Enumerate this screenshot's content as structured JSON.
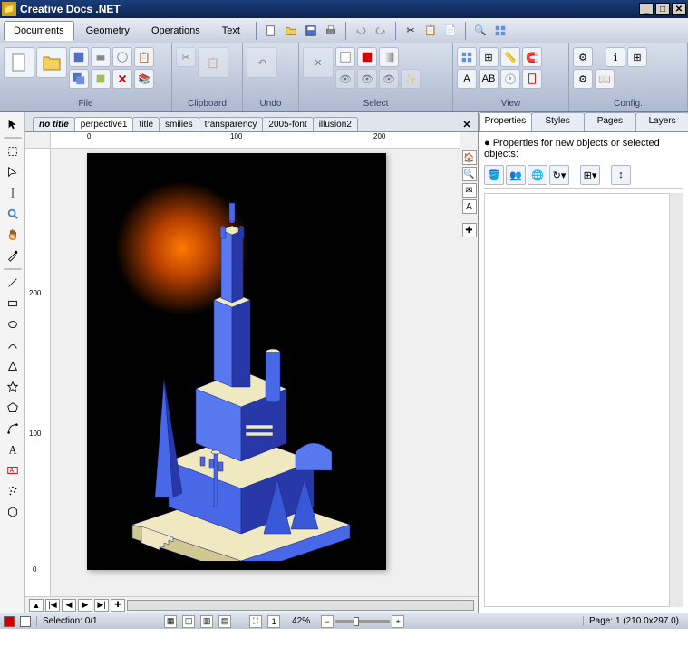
{
  "title": "Creative Docs .NET",
  "menu": {
    "tabs": [
      "Documents",
      "Geometry",
      "Operations",
      "Text"
    ],
    "active": 0
  },
  "ribbon": {
    "groups": {
      "file": "File",
      "clipboard": "Clipboard",
      "undo": "Undo",
      "select": "Select",
      "view": "View",
      "config": "Config."
    }
  },
  "doctabs": {
    "items": [
      "no title",
      "perpective1",
      "title",
      "smilies",
      "transparency",
      "2005-font",
      "illusion2"
    ],
    "active": 1
  },
  "ruler_h": [
    "0",
    "100",
    "200"
  ],
  "ruler_v": [
    "0",
    "100",
    "200"
  ],
  "rightpanel": {
    "tabs": [
      "Properties",
      "Styles",
      "Pages",
      "Layers"
    ],
    "active": 0,
    "heading": "● Properties for new objects or selected objects:"
  },
  "status": {
    "selection_label": "Selection:",
    "selection_value": "0/1",
    "zoom": "42%",
    "page_label": "Page:",
    "page_value": "1 (210.0x297.0)"
  },
  "colors": {
    "fg": "#cc0000",
    "bg": "#ffffff"
  },
  "vcontrols": [
    "🏠",
    "🔍",
    "✉",
    "A",
    "",
    "✚"
  ]
}
